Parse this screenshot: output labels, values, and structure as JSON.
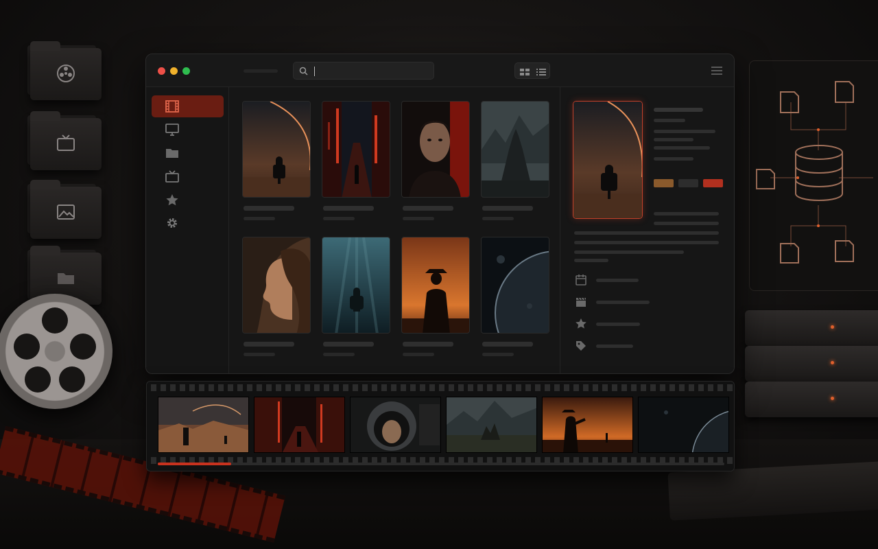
{
  "window": {
    "traffic_lights": [
      "#ee5048",
      "#f1b22c",
      "#2fbd4f"
    ],
    "search": {
      "value": "",
      "placeholder": ""
    },
    "view_modes": [
      "grid-view",
      "list-view"
    ]
  },
  "sidebar": {
    "items": [
      {
        "icon": "film-icon",
        "active": true
      },
      {
        "icon": "monitor-icon",
        "active": false
      },
      {
        "icon": "folder-icon",
        "active": false
      },
      {
        "icon": "tv-icon",
        "active": false
      },
      {
        "icon": "star-icon",
        "active": false
      },
      {
        "icon": "gear-icon",
        "active": false
      }
    ]
  },
  "library": {
    "cards": [
      {
        "poster": "astronaut-desert-planet"
      },
      {
        "poster": "red-neon-city-street"
      },
      {
        "poster": "man-portrait-red-light"
      },
      {
        "poster": "mountain-castle"
      },
      {
        "poster": "woman-profile"
      },
      {
        "poster": "underwater-diver"
      },
      {
        "poster": "cowboy-sunset"
      },
      {
        "poster": "planet-in-space"
      }
    ]
  },
  "detail": {
    "poster": "astronaut-desert-planet",
    "swatches": [
      "#8a5a2c",
      "#2d2d2d",
      "#b2301f"
    ],
    "meta_icons": [
      "calendar-icon",
      "clapperboard-icon",
      "star-icon",
      "tag-icon"
    ]
  },
  "filmstrip": {
    "frames": [
      "desert-astronaut",
      "neon-city-walker",
      "astronaut-helmet-portrait",
      "mountain-castle-valley",
      "cowboy-sunset-desert",
      "dark-planet"
    ],
    "progress": 0.13
  },
  "colors": {
    "accent": "#c8321e",
    "active_nav": "#6a1d12"
  }
}
